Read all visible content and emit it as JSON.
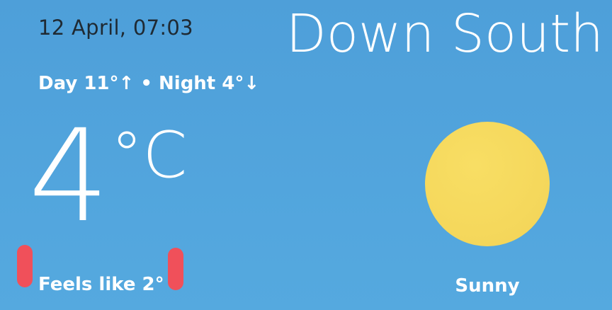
{
  "header": {
    "datetime": "12 April, 07:03",
    "location": "Down South"
  },
  "forecast": {
    "day_night": "Day 11°↑ • Night 4°↓"
  },
  "current": {
    "temperature": "4",
    "unit": "°C",
    "feels_like": "Feels like 2°",
    "condition": "Sunny",
    "icon": "sun-icon"
  },
  "colors": {
    "background": "#52a5dd",
    "sun": "#f5d85c",
    "marker": "#f0505a",
    "datetime_text": "#1f2a33"
  }
}
